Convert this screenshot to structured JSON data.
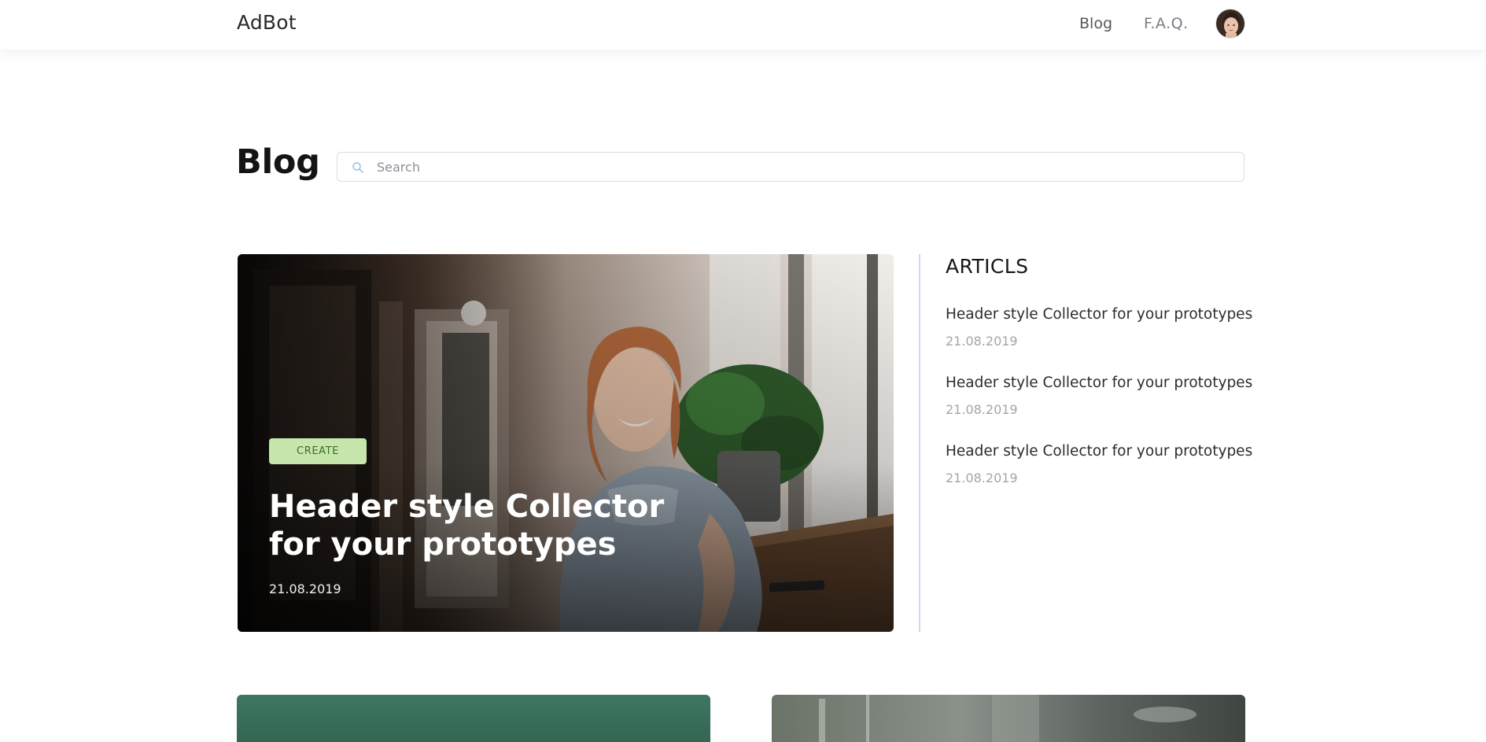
{
  "header": {
    "logo": "AdBot",
    "nav": [
      {
        "label": "Blog"
      },
      {
        "label": "F.A.Q."
      }
    ]
  },
  "page": {
    "title": "Blog",
    "search": {
      "placeholder": "Search",
      "value": ""
    }
  },
  "featured": {
    "tag": "CREATE",
    "title": "Header style Collector for your prototypes",
    "date": "21.08.2019",
    "tag_color": "#c6e6ac"
  },
  "sidebar": {
    "heading": "ARTICLS",
    "articles": [
      {
        "title": "Header style Collector for your prototypes",
        "date": "21.08.2019"
      },
      {
        "title": "Header style Collector for your prototypes",
        "date": "21.08.2019"
      },
      {
        "title": "Header style Collector for your prototypes",
        "date": "21.08.2019"
      }
    ]
  },
  "icons": {
    "search": "search-icon",
    "avatar": "user-avatar"
  }
}
